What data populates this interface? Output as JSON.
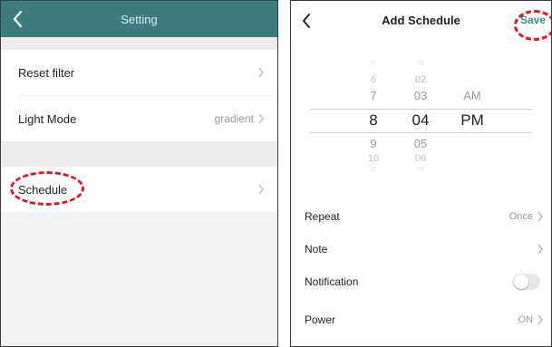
{
  "left_screen": {
    "title": "Setting",
    "items": [
      {
        "label": "Reset filter",
        "value": ""
      },
      {
        "label": "Light Mode",
        "value": "gradient"
      },
      {
        "label": "Schedule",
        "value": ""
      }
    ]
  },
  "right_screen": {
    "title": "Add Schedule",
    "save_label": "Save",
    "picker": {
      "hours": [
        "5",
        "6",
        "7",
        "8",
        "9",
        "10",
        "11"
      ],
      "minutes": [
        "01",
        "02",
        "03",
        "04",
        "05",
        "06",
        "07"
      ],
      "ampm": [
        "AM",
        "PM"
      ],
      "selected": {
        "hour": "8",
        "minute": "04",
        "ampm": "PM"
      }
    },
    "rows": [
      {
        "label": "Repeat",
        "value": "Once"
      },
      {
        "label": "Note",
        "value": ""
      },
      {
        "label": "Notification",
        "toggle": false
      },
      {
        "label": "Power",
        "value": "ON"
      }
    ]
  },
  "colors": {
    "header": "#3c7b7e",
    "accent": "#3c8a8d",
    "highlight": "#e3161f"
  }
}
